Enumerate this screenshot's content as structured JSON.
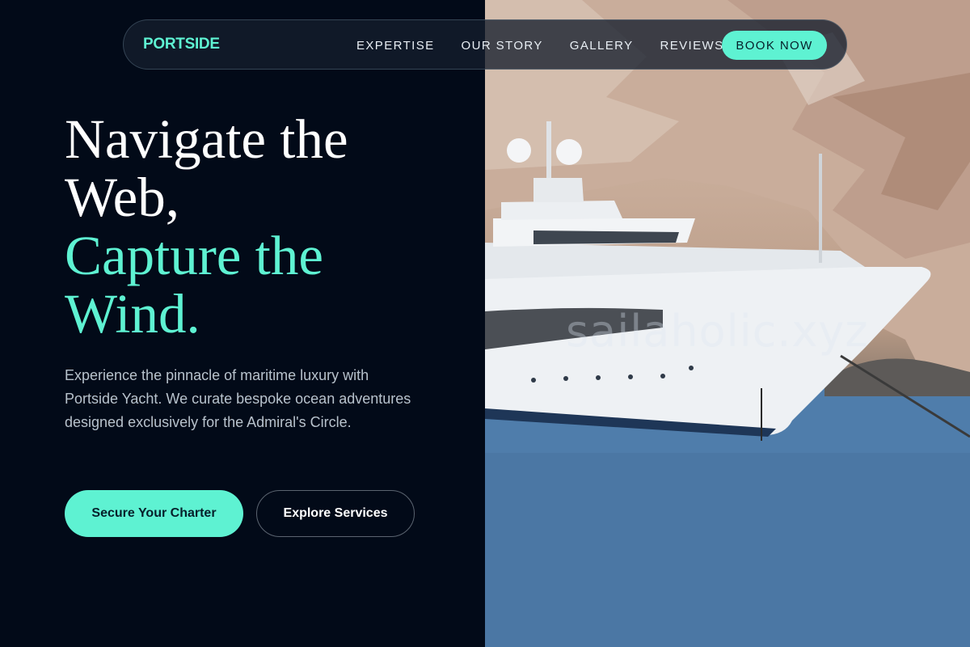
{
  "nav": {
    "brand": "PORTSIDE",
    "links": [
      "EXPERTISE",
      "OUR STORY",
      "GALLERY",
      "REVIEWS"
    ],
    "cta": "BOOK NOW"
  },
  "hero": {
    "headline_line1": "Navigate the",
    "headline_line2": "Web,",
    "headline_accent1": "Capture the",
    "headline_accent2": "Wind.",
    "description": "Experience the pinnacle of maritime luxury with Portside Yacht. We curate bespoke ocean adventures designed exclusively for the Admiral's Circle.",
    "primary_cta": "Secure Your Charter",
    "secondary_cta": "Explore Services"
  },
  "image": {
    "subject": "yacht-photo",
    "watermark": "sailaholic.xyz"
  },
  "colors": {
    "accent": "#5ef2d2",
    "background": "#020a18",
    "text_primary": "#ffffff",
    "text_muted": "#b8c2cc"
  }
}
